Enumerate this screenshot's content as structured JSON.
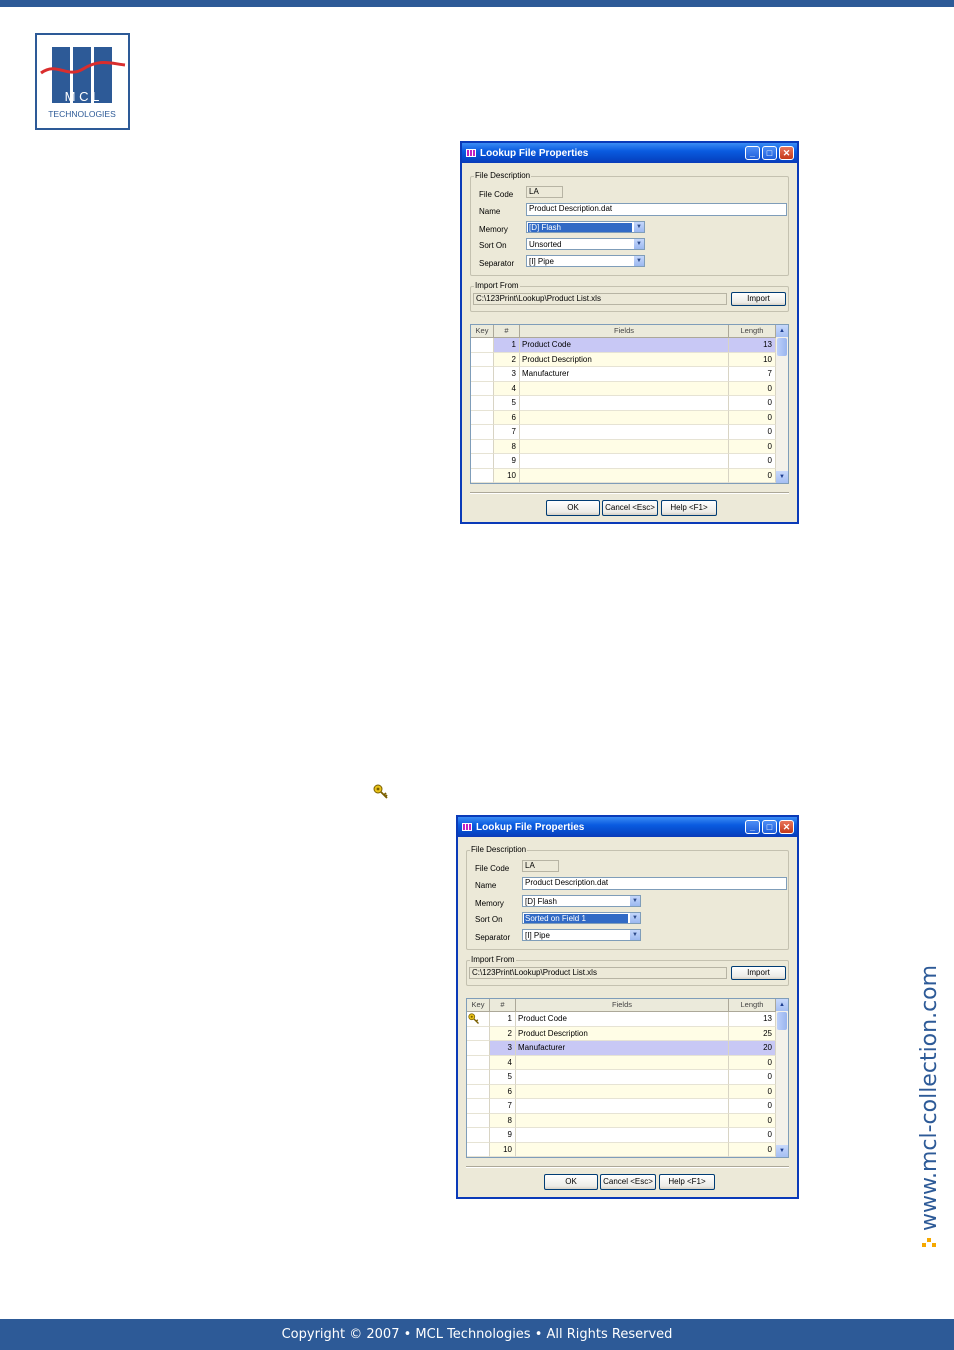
{
  "header": {
    "brand_lines": [
      "M C L",
      "TECHNOLOGIES"
    ]
  },
  "side_url": "www.mcl-collection.com",
  "footer": {
    "text": "Copyright © 2007 • MCL Technologies • All Rights Reserved"
  },
  "colors": {
    "brand_blue": "#2d5a97",
    "accent_orange": "#f5a800",
    "xp_title": "#0a3ab8",
    "row_selected": "#c8c8f5",
    "row_alt": "#fffde6"
  },
  "dialogs": [
    {
      "title": "Lookup File Properties",
      "file_description_label": "File Description",
      "labels": {
        "file_code": "File Code",
        "name": "Name",
        "memory": "Memory",
        "sort_on": "Sort On",
        "separator": "Separator"
      },
      "file_code": "LA",
      "name": "Product Description.dat",
      "memory": "[D] Flash",
      "sort_on": "Unsorted",
      "separator": "[I] Pipe",
      "focused_combo": "memory",
      "import_from_label": "Import From",
      "import_path": "C:\\123Print\\Lookup\\Product List.xls",
      "import_button": "Import",
      "grid": {
        "headers": {
          "key": "Key",
          "num": "#",
          "fields": "Fields",
          "length": "Length"
        },
        "rows": [
          {
            "num": "1",
            "name": "Product Code",
            "length": "13",
            "selected": true,
            "key": false
          },
          {
            "num": "2",
            "name": "Product Description",
            "length": "10",
            "selected": false,
            "key": false
          },
          {
            "num": "3",
            "name": "Manufacturer",
            "length": "7",
            "selected": false,
            "key": false
          },
          {
            "num": "4",
            "name": "",
            "length": "0",
            "selected": false,
            "key": false
          },
          {
            "num": "5",
            "name": "",
            "length": "0",
            "selected": false,
            "key": false
          },
          {
            "num": "6",
            "name": "",
            "length": "0",
            "selected": false,
            "key": false
          },
          {
            "num": "7",
            "name": "",
            "length": "0",
            "selected": false,
            "key": false
          },
          {
            "num": "8",
            "name": "",
            "length": "0",
            "selected": false,
            "key": false
          },
          {
            "num": "9",
            "name": "",
            "length": "0",
            "selected": false,
            "key": false
          },
          {
            "num": "10",
            "name": "",
            "length": "0",
            "selected": false,
            "key": false
          }
        ]
      },
      "buttons": {
        "ok": "OK",
        "cancel": "Cancel <Esc>",
        "help": "Help <F1>"
      }
    },
    {
      "title": "Lookup File Properties",
      "file_description_label": "File Description",
      "labels": {
        "file_code": "File Code",
        "name": "Name",
        "memory": "Memory",
        "sort_on": "Sort On",
        "separator": "Separator"
      },
      "file_code": "LA",
      "name": "Product Description.dat",
      "memory": "[D] Flash",
      "sort_on": "Sorted on Field 1",
      "separator": "[I] Pipe",
      "focused_combo": "sort_on",
      "import_from_label": "Import From",
      "import_path": "C:\\123Print\\Lookup\\Product List.xls",
      "import_button": "Import",
      "grid": {
        "headers": {
          "key": "Key",
          "num": "#",
          "fields": "Fields",
          "length": "Length"
        },
        "rows": [
          {
            "num": "1",
            "name": "Product Code",
            "length": "13",
            "selected": false,
            "key": true
          },
          {
            "num": "2",
            "name": "Product Description",
            "length": "25",
            "selected": false,
            "key": false
          },
          {
            "num": "3",
            "name": "Manufacturer",
            "length": "20",
            "selected": true,
            "key": false
          },
          {
            "num": "4",
            "name": "",
            "length": "0",
            "selected": false,
            "key": false
          },
          {
            "num": "5",
            "name": "",
            "length": "0",
            "selected": false,
            "key": false
          },
          {
            "num": "6",
            "name": "",
            "length": "0",
            "selected": false,
            "key": false
          },
          {
            "num": "7",
            "name": "",
            "length": "0",
            "selected": false,
            "key": false
          },
          {
            "num": "8",
            "name": "",
            "length": "0",
            "selected": false,
            "key": false
          },
          {
            "num": "9",
            "name": "",
            "length": "0",
            "selected": false,
            "key": false
          },
          {
            "num": "10",
            "name": "",
            "length": "0",
            "selected": false,
            "key": false
          }
        ]
      },
      "buttons": {
        "ok": "OK",
        "cancel": "Cancel <Esc>",
        "help": "Help <F1>"
      }
    }
  ]
}
